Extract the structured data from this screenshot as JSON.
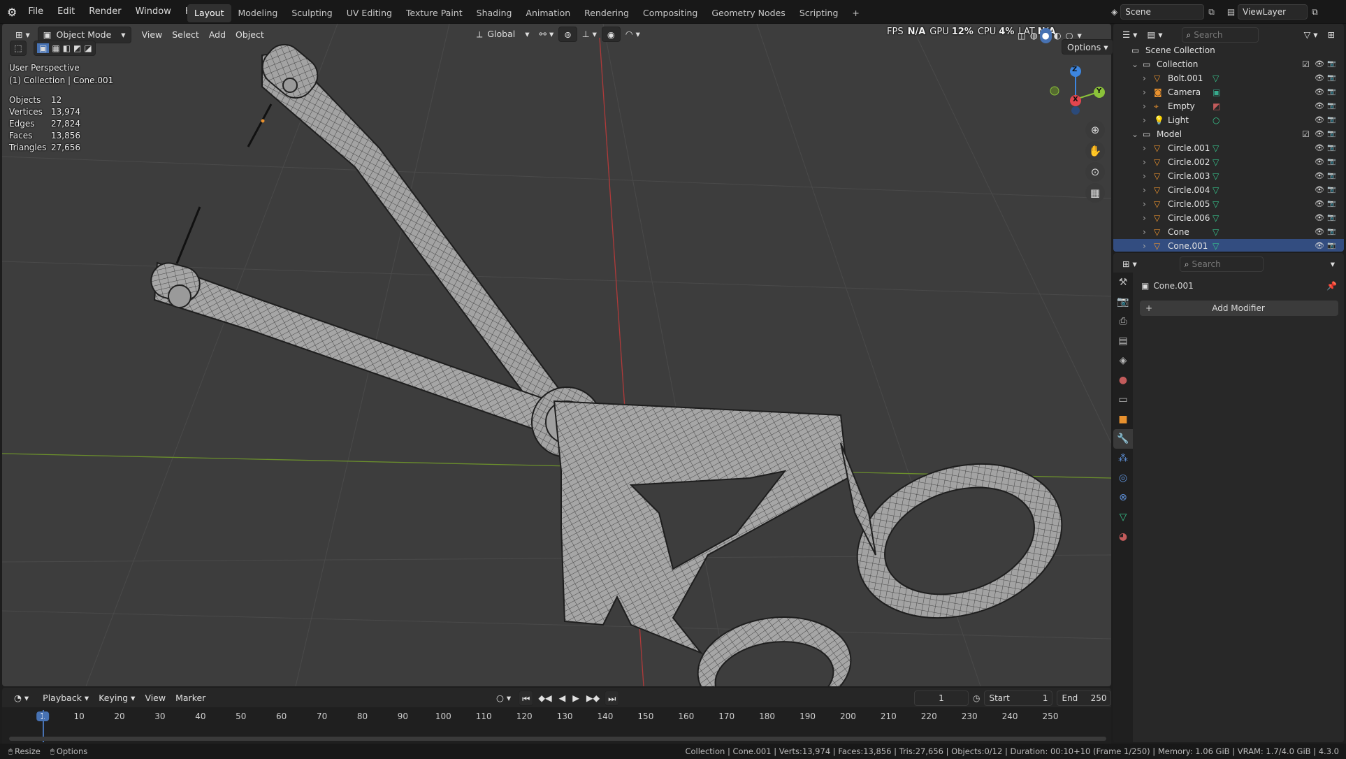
{
  "topbar": {
    "menus": [
      "File",
      "Edit",
      "Render",
      "Window",
      "Help"
    ],
    "workspaces": [
      "Layout",
      "Modeling",
      "Sculpting",
      "UV Editing",
      "Texture Paint",
      "Shading",
      "Animation",
      "Rendering",
      "Compositing",
      "Geometry Nodes",
      "Scripting"
    ],
    "active_workspace": "Layout",
    "add_workspace": "+",
    "scene": "Scene",
    "view_layer": "ViewLayer"
  },
  "viewport_header": {
    "mode": "Object Mode",
    "menus": [
      "View",
      "Select",
      "Add",
      "Object"
    ],
    "orientation": "Global",
    "options": "Options"
  },
  "perf": {
    "fps_label": "FPS",
    "fps_value": "N/A",
    "gpu": "GPU",
    "gpu_value": "12%",
    "cpu": "CPU",
    "cpu_value": "4%",
    "lat": "LAT",
    "lat_value": "N/A"
  },
  "overlay": {
    "view_name": "User Perspective",
    "context": "(1) Collection | Cone.001",
    "stats": [
      {
        "label": "Objects",
        "value": "12"
      },
      {
        "label": "Vertices",
        "value": "13,974"
      },
      {
        "label": "Edges",
        "value": "27,824"
      },
      {
        "label": "Faces",
        "value": "13,856"
      },
      {
        "label": "Triangles",
        "value": "27,656"
      }
    ],
    "axes": {
      "x": "X",
      "y": "Y",
      "z": "Z"
    }
  },
  "outliner": {
    "search_placeholder": "Search",
    "scene_collection": "Scene Collection",
    "collections": [
      {
        "name": "Collection",
        "items": [
          {
            "name": "Bolt.001",
            "icon": "mesh-icon"
          },
          {
            "name": "Camera",
            "icon": "camera-icon"
          },
          {
            "name": "Empty",
            "icon": "empty-icon"
          },
          {
            "name": "Light",
            "icon": "light-icon"
          }
        ]
      },
      {
        "name": "Model",
        "items": [
          {
            "name": "Circle.001",
            "icon": "mesh-icon"
          },
          {
            "name": "Circle.002",
            "icon": "mesh-icon"
          },
          {
            "name": "Circle.003",
            "icon": "mesh-icon"
          },
          {
            "name": "Circle.004",
            "icon": "mesh-icon"
          },
          {
            "name": "Circle.005",
            "icon": "mesh-icon"
          },
          {
            "name": "Circle.006",
            "icon": "mesh-icon"
          },
          {
            "name": "Cone",
            "icon": "mesh-icon"
          },
          {
            "name": "Cone.001",
            "icon": "mesh-icon"
          }
        ]
      }
    ]
  },
  "properties": {
    "search_placeholder": "Search",
    "object_name": "Cone.001",
    "add_modifier": "Add Modifier"
  },
  "timeline": {
    "menus": [
      "Playback",
      "Keying",
      "View",
      "Marker"
    ],
    "current_frame": "1",
    "start_label": "Start",
    "start": "1",
    "end_label": "End",
    "end": "250",
    "ticks": [
      "1",
      "10",
      "20",
      "30",
      "40",
      "50",
      "60",
      "70",
      "80",
      "90",
      "100",
      "110",
      "120",
      "130",
      "140",
      "150",
      "160",
      "170",
      "180",
      "190",
      "200",
      "210",
      "220",
      "230",
      "240",
      "250"
    ]
  },
  "statusbar": {
    "left": [
      {
        "icon": "mouse-icon",
        "label": "Resize"
      },
      {
        "icon": "mouse-icon",
        "label": "Options"
      }
    ],
    "right": "Collection | Cone.001 | Verts:13,974 | Faces:13,856 | Tris:27,656 | Objects:0/12 | Duration: 00:10+10 (Frame 1/250) | Memory: 1.06 GiB | VRAM: 1.7/4.0 GiB | 4.3.0"
  },
  "colors": {
    "accent": "#4772b3",
    "selected_row": "#334d80",
    "mesh_icon": "#e8912e",
    "mesh_data": "#37c48c",
    "x_axis": "#e2464f",
    "y_axis": "#8bc23a",
    "z_axis": "#3d86e0"
  }
}
